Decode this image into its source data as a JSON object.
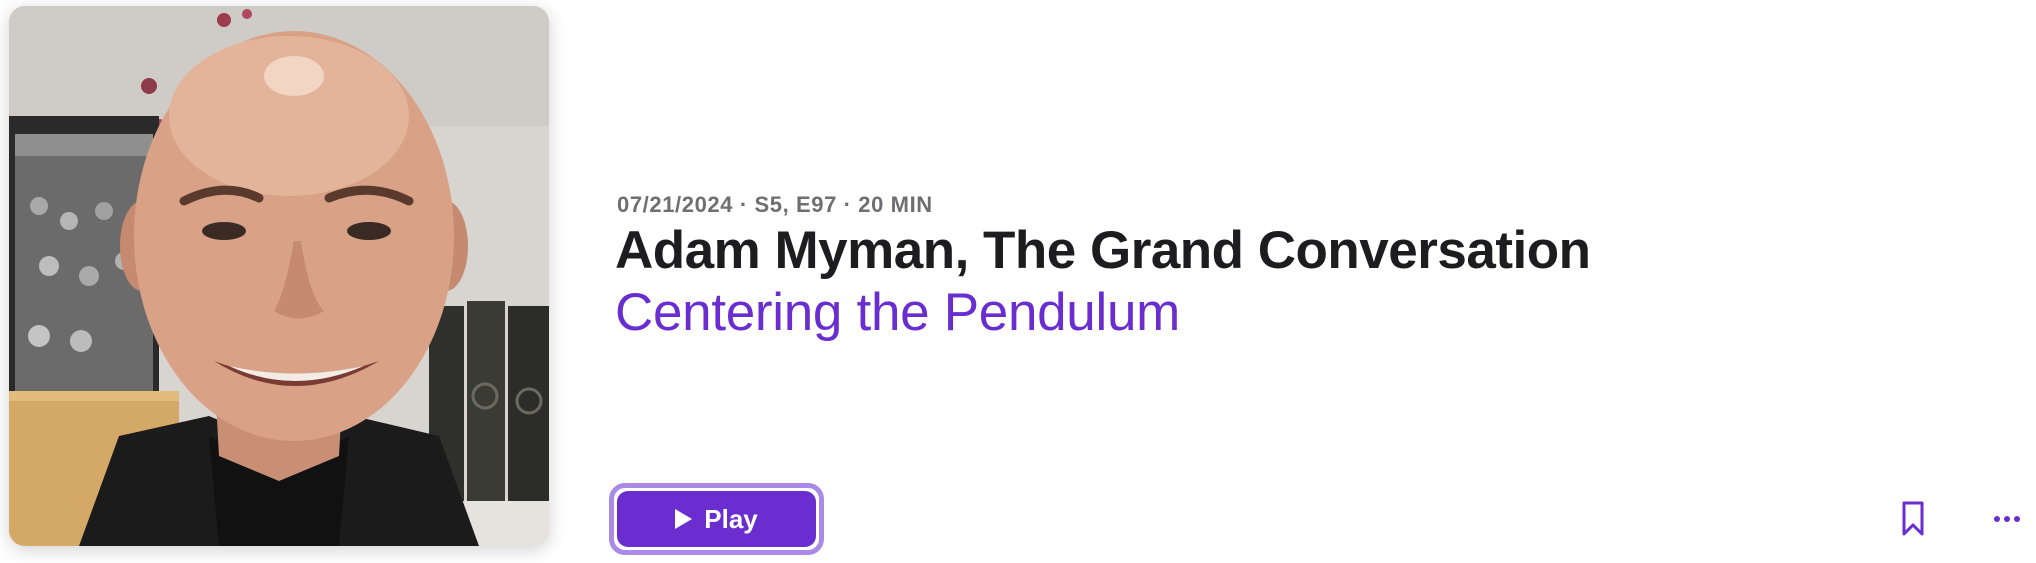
{
  "episode": {
    "meta": "07/21/2024 · S5, E97 · 20 MIN",
    "title": "Adam Myman, The Grand Conversation",
    "show_name": "Centering the Pendulum"
  },
  "actions": {
    "play_label": "Play",
    "play_icon": "play-icon",
    "bookmark_icon": "bookmark-icon",
    "more_icon": "ellipsis-icon"
  },
  "colors": {
    "accent": "#6a2ed0",
    "accent_ring": "#a98ae6",
    "title": "#1d1d1f",
    "meta": "#6e6e73"
  }
}
